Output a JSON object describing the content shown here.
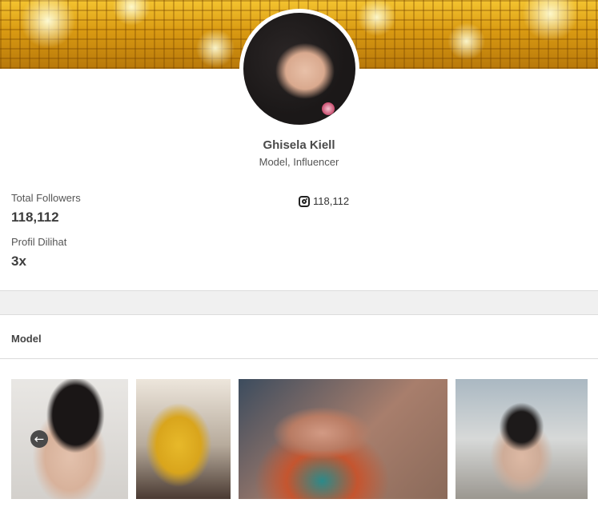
{
  "profile": {
    "name": "Ghisela Kiell",
    "role": "Model, Influencer"
  },
  "stats": {
    "followers_label": "Total Followers",
    "followers_value": "118,112",
    "views_label": "Profil Dilihat",
    "views_value": "3x"
  },
  "instagram": {
    "icon": "instagram-icon",
    "count": "118,112"
  },
  "section": {
    "title": "Model"
  },
  "gallery": {
    "prev_icon": "arrow-left-icon",
    "prev_glyph": "←"
  }
}
